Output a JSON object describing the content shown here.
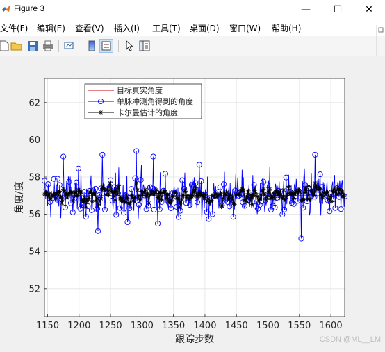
{
  "window": {
    "title": "Figure 3",
    "minimize": "—",
    "maximize": "☐",
    "close": "✕"
  },
  "menu": [
    "文件(F)",
    "编辑(E)",
    "查看(V)",
    "插入(I)",
    "工具(T)",
    "桌面(D)",
    "窗口(W)",
    "帮助(H)"
  ],
  "toolbar": [
    "new-figure",
    "open-file",
    "save",
    "print",
    "link-plot",
    "insert-colorbar",
    "insert-legend",
    "edit-plot",
    "property-inspector"
  ],
  "watermark": "CSDN @ML__LM",
  "colors": {
    "measured": "#0000ff",
    "kalman": "#000000",
    "true": "#cc0000",
    "axes_bg": "#ffffff",
    "grid": "#e3e3e3"
  },
  "chart_data": {
    "type": "line",
    "xlabel": "跟踪步数",
    "ylabel": "角度/度",
    "xlim": [
      1145,
      1622
    ],
    "ylim": [
      50.5,
      63.3
    ],
    "xticks": [
      1150,
      1200,
      1250,
      1300,
      1350,
      1400,
      1450,
      1500,
      1550,
      1600
    ],
    "yticks": [
      52,
      54,
      56,
      58,
      60,
      62
    ],
    "grid": true,
    "legend_position": "top-left",
    "legend": [
      "目标真实角度",
      "单脉冲测角得到的角度",
      "卡尔曼估计的角度"
    ],
    "series": [
      {
        "name": "目标真实角度",
        "marker": "none",
        "x_start": 1145,
        "x_end": 1622,
        "value": 57.0
      },
      {
        "name": "单脉冲测角得到的角度",
        "marker": "o",
        "x_start": 1145,
        "step": 1,
        "y_range": [
          54.7,
          59.4
        ],
        "notable_points": [
          [
            1175,
            59.1
          ],
          [
            1237,
            59.2
          ],
          [
            1291,
            59.4
          ],
          [
            1318,
            59.1
          ],
          [
            1553,
            54.7
          ],
          [
            1575,
            59.2
          ],
          [
            1230,
            55.1
          ]
        ]
      },
      {
        "name": "卡尔曼估计的角度",
        "marker": "*",
        "x_start": 1145,
        "step": 1,
        "y_range": [
          56.0,
          58.2
        ]
      }
    ]
  }
}
